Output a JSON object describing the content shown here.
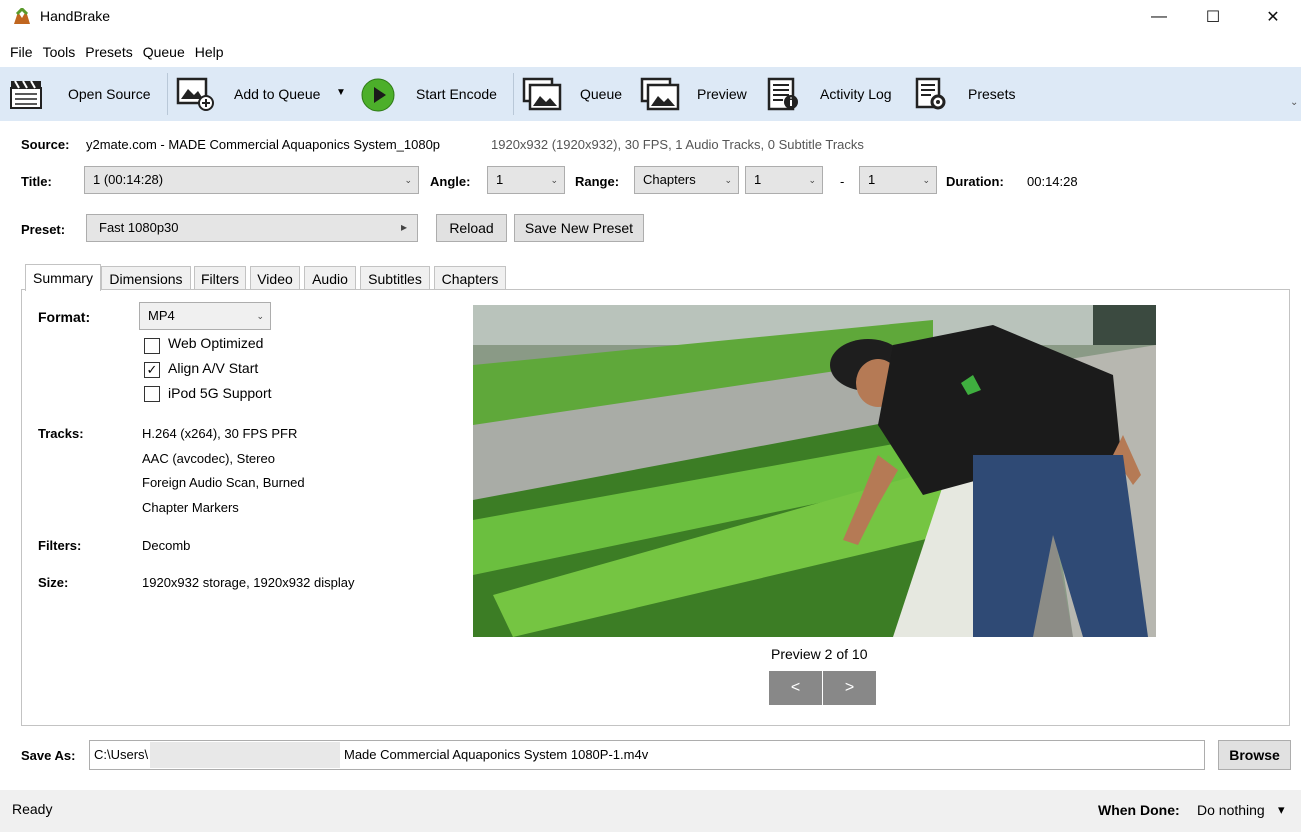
{
  "window": {
    "title": "HandBrake",
    "minimize": "—",
    "maximize": "☐",
    "close": "✕"
  },
  "menu": [
    "File",
    "Tools",
    "Presets",
    "Queue",
    "Help"
  ],
  "toolbar": {
    "open_source": "Open Source",
    "add_to_queue": "Add to Queue",
    "add_to_queue_arrow": "▼",
    "start_encode": "Start Encode",
    "queue": "Queue",
    "preview": "Preview",
    "activity_log": "Activity Log",
    "presets": "Presets",
    "overflow": "⌄"
  },
  "source": {
    "label": "Source:",
    "name": "y2mate.com - MADE Commercial Aquaponics System_1080p",
    "info": "1920x932 (1920x932), 30 FPS, 1 Audio Tracks, 0 Subtitle Tracks"
  },
  "title_row": {
    "title_label": "Title:",
    "title_value": "1 (00:14:28)",
    "angle_label": "Angle:",
    "angle_value": "1",
    "range_label": "Range:",
    "range_value": "Chapters",
    "range_start": "1",
    "range_dash": "-",
    "range_end": "1",
    "duration_label": "Duration:",
    "duration_value": "00:14:28"
  },
  "preset_row": {
    "label": "Preset:",
    "value": "Fast 1080p30",
    "arrow": "▸",
    "reload": "Reload",
    "save_new": "Save New Preset"
  },
  "tabs": [
    "Summary",
    "Dimensions",
    "Filters",
    "Video",
    "Audio",
    "Subtitles",
    "Chapters"
  ],
  "summary": {
    "format_label": "Format:",
    "format_value": "MP4",
    "checkboxes": [
      {
        "label": "Web Optimized",
        "checked": false
      },
      {
        "label": "Align A/V Start",
        "checked": true
      },
      {
        "label": "iPod 5G Support",
        "checked": false
      }
    ],
    "tracks_label": "Tracks:",
    "tracks": [
      "H.264 (x264), 30 FPS PFR",
      "AAC (avcodec), Stereo",
      "Foreign Audio Scan, Burned",
      "Chapter Markers"
    ],
    "filters_label": "Filters:",
    "filters_value": "Decomb",
    "size_label": "Size:",
    "size_value": "1920x932 storage, 1920x932 display",
    "preview_caption": "Preview 2 of 10",
    "prev_btn": "<",
    "next_btn": ">"
  },
  "save_as": {
    "label": "Save As:",
    "path_prefix": "C:\\Users\\",
    "path_suffix": "Made Commercial Aquaponics System 1080P-1.m4v",
    "browse": "Browse"
  },
  "status": {
    "text": "Ready",
    "when_done_label": "When Done:",
    "when_done_value": "Do nothing",
    "when_done_arrow": "▾"
  },
  "colors": {
    "toolbar_bg": "#dde9f6",
    "play_green": "#4caf2a",
    "nav_btn": "#888888"
  }
}
